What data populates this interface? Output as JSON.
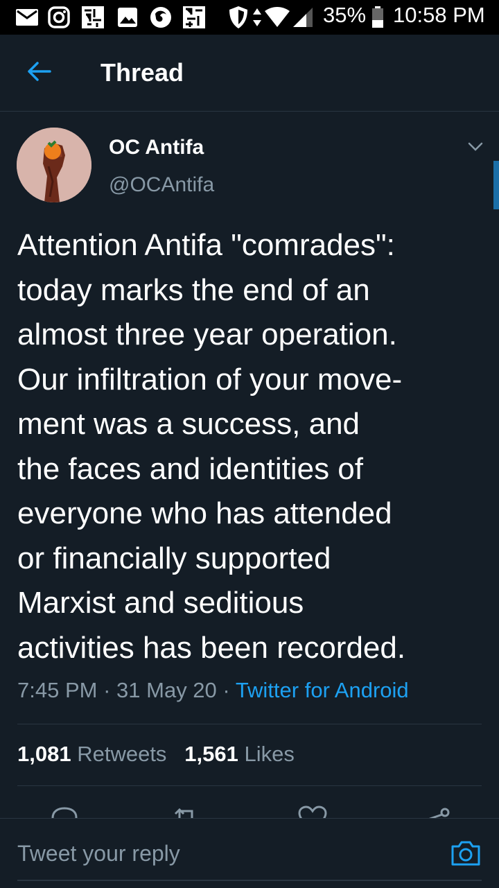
{
  "status_bar": {
    "battery": "35%",
    "time": "10:58 PM",
    "icons": [
      "mail-icon",
      "instagram-icon",
      "app-icon",
      "gallery-icon",
      "firefox-icon",
      "app-icon",
      "shield-icon",
      "data-arrows-icon",
      "wifi-icon",
      "signal-icon",
      "battery-icon"
    ]
  },
  "header": {
    "title": "Thread",
    "back_icon": "back-arrow-icon"
  },
  "tweet": {
    "author": {
      "name": "OC Antifa",
      "handle": "@OCAntifa",
      "avatar_icon": "raised-fist-orange-icon"
    },
    "text_lines": [
      "Attention Antifa \"comrades\":",
      "today marks the end of an",
      "almost three year operation.",
      "Our infiltration of your move-",
      "ment was a success, and",
      "the faces and identities of",
      "everyone who has attended",
      "or financially supported",
      "Marxist and seditious",
      "activities has been recorded."
    ],
    "time": "7:45 PM",
    "date": "31 May 20",
    "separator": "·",
    "source": "Twitter for Android",
    "retweets_count": "1,081",
    "retweets_label": "Retweets",
    "likes_count": "1,561",
    "likes_label": "Likes"
  },
  "actions": [
    "reply-icon",
    "retweet-icon",
    "like-icon",
    "share-icon"
  ],
  "reply_bar": {
    "placeholder": "Tweet your reply",
    "camera_icon": "camera-icon"
  },
  "colors": {
    "background": "#141d26",
    "accent": "#1da1f2",
    "muted": "#8899a6",
    "divider": "#2a3642"
  }
}
